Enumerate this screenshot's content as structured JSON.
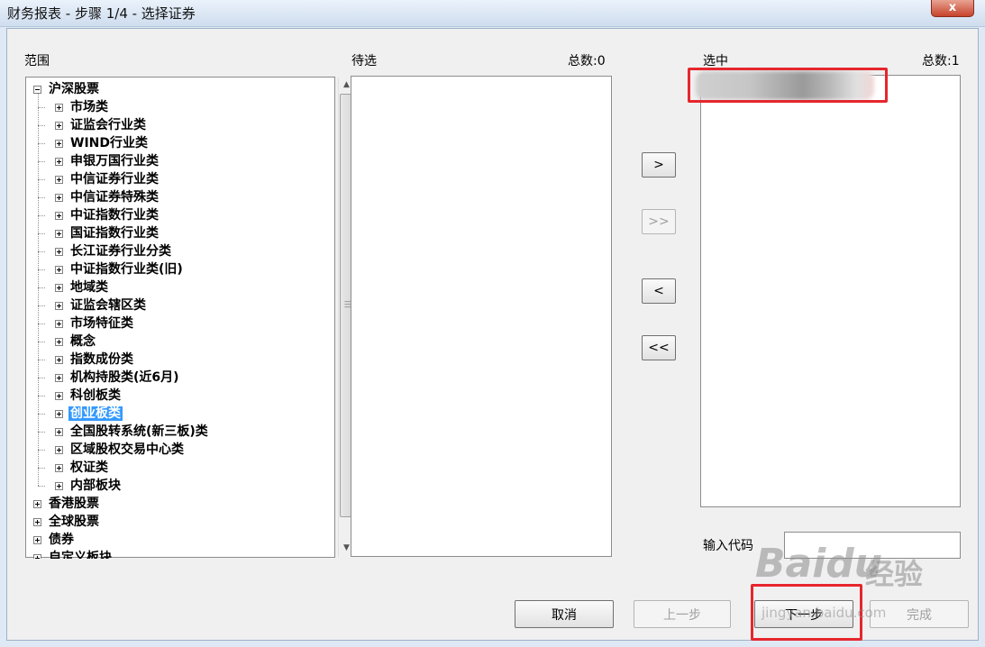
{
  "window": {
    "title": "财务报表 - 步骤 1/4 - 选择证券",
    "close_label": "x"
  },
  "scope": {
    "label": "范围",
    "tree": [
      {
        "label": "沪深股票",
        "level": 0,
        "expanded": true
      },
      {
        "label": "市场类",
        "level": 1
      },
      {
        "label": "证监会行业类",
        "level": 1
      },
      {
        "label": "WIND行业类",
        "level": 1
      },
      {
        "label": "申银万国行业类",
        "level": 1
      },
      {
        "label": "中信证券行业类",
        "level": 1
      },
      {
        "label": "中信证券特殊类",
        "level": 1
      },
      {
        "label": "中证指数行业类",
        "level": 1
      },
      {
        "label": "国证指数行业类",
        "level": 1
      },
      {
        "label": "长江证券行业分类",
        "level": 1
      },
      {
        "label": "中证指数行业类(旧)",
        "level": 1
      },
      {
        "label": "地域类",
        "level": 1
      },
      {
        "label": "证监会辖区类",
        "level": 1
      },
      {
        "label": "市场特征类",
        "level": 1
      },
      {
        "label": "概念",
        "level": 1
      },
      {
        "label": "指数成份类",
        "level": 1
      },
      {
        "label": "机构持股类(近6月)",
        "level": 1
      },
      {
        "label": "科创板类",
        "level": 1
      },
      {
        "label": "创业板类",
        "level": 1,
        "selected": true
      },
      {
        "label": "全国股转系统(新三板)类",
        "level": 1
      },
      {
        "label": "区域股权交易中心类",
        "level": 1
      },
      {
        "label": "权证类",
        "level": 1
      },
      {
        "label": "内部板块",
        "level": 1
      },
      {
        "label": "香港股票",
        "level": 0
      },
      {
        "label": "全球股票",
        "level": 0
      },
      {
        "label": "债券",
        "level": 0
      },
      {
        "label": "自定义板块",
        "level": 0
      }
    ]
  },
  "pending": {
    "label": "待选",
    "count_label": "总数:0"
  },
  "selected": {
    "label": "选中",
    "count_label": "总数:1"
  },
  "transfer": {
    "add": ">",
    "add_all": ">>",
    "remove": "<",
    "remove_all": "<<"
  },
  "code_input": {
    "label": "输入代码",
    "value": ""
  },
  "footer": {
    "cancel": "取消",
    "prev": "上一步",
    "next": "下一步",
    "finish": "完成"
  },
  "watermark": {
    "brand": "Baidu",
    "brand_cn": "经验",
    "url": "jingyan.baidu.com"
  },
  "colors": {
    "highlight": "#e6262d",
    "selection": "#3399ff"
  }
}
